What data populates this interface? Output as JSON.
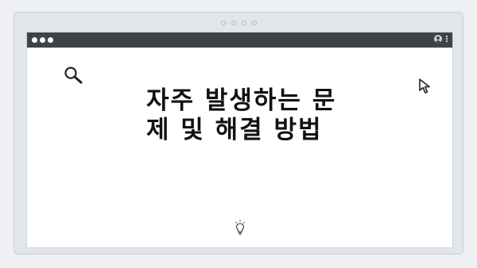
{
  "window": {
    "headline": "자주 발생하는 문제 및 해결 방법"
  },
  "icons": {
    "search": "search-icon",
    "cursor": "cursor-icon",
    "lightbulb": "lightbulb-icon",
    "user": "user-icon",
    "menu": "kebab-menu-icon"
  },
  "colors": {
    "page_background": "#eef0f3",
    "frame_background": "#e2e6ea",
    "titlebar": "#3f4349",
    "content_background": "#ffffff",
    "text": "#111111"
  }
}
